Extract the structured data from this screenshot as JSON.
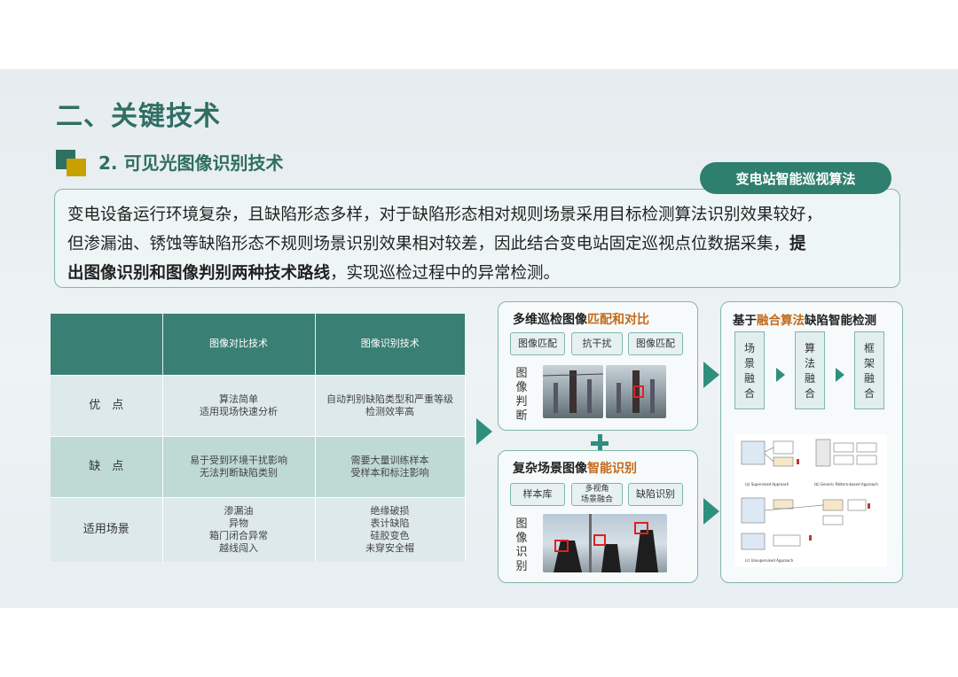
{
  "slide": {
    "title": "二、关键技术",
    "subtitle": "2. 可见光图像识别技术",
    "badge": "变电站智能巡视算法",
    "intro": {
      "line1": "变电设备运行环境复杂，且缺陷形态多样，对于缺陷形态相对规则场景采用目标检测算法识别效果较好，",
      "line2a": "但渗漏油、锈蚀等缺陷形态不规则场景识别效果相对较差，因此结合变电站固定巡视点位数据采集，",
      "line2b": "提",
      "line3a": "出图像识别和图像判别两种技术路线",
      "line3b": "，实现巡检过程中的异常检测。"
    }
  },
  "table": {
    "headers": [
      "",
      "图像对比技术",
      "图像识别技术"
    ],
    "rows": [
      {
        "label": "优　点",
        "col1": [
          "算法简单",
          "适用现场快速分析"
        ],
        "col2": [
          "自动判别缺陷类型和严重等级",
          "检测效率高"
        ]
      },
      {
        "label": "缺　点",
        "col1": [
          "易于受到环境干扰影响",
          "无法判断缺陷类别"
        ],
        "col2": [
          "需要大量训练样本",
          "受样本和标注影响"
        ]
      },
      {
        "label": "适用场景",
        "col1": [
          "渗漏油",
          "异物",
          "箱门闭合异常",
          "越线闯入"
        ],
        "col2": [
          "绝缘破损",
          "表计缺陷",
          "硅胶变色",
          "未穿安全帽"
        ]
      }
    ]
  },
  "panel_compare": {
    "title_a": "多维巡检图像",
    "title_hl": "匹配和对比",
    "chips": [
      "图像匹配",
      "抗干扰",
      "图像匹配"
    ],
    "vlabel": [
      "图",
      "像",
      "判",
      "断"
    ]
  },
  "panel_recognize": {
    "title_a": "复杂场景图像",
    "title_hl": "智能识别",
    "chips": [
      "样本库",
      "多视角\n场景融合",
      "缺陷识别"
    ],
    "vlabel": [
      "图",
      "像",
      "识",
      "别"
    ]
  },
  "panel_fusion": {
    "title_a": "基于",
    "title_hl": "融合算法",
    "title_b": "缺陷智能检测",
    "boxes": [
      [
        "场",
        "景",
        "融",
        "合"
      ],
      [
        "算",
        "法",
        "融",
        "合"
      ],
      [
        "框",
        "架",
        "融",
        "合"
      ]
    ],
    "diagram_labels": [
      "(a) Supervised Approach",
      "(b) Generic Pattern-based Approach",
      "(c) Unsupervised Approach"
    ]
  },
  "colors": {
    "accent": "#2f6f64",
    "arrow": "#2f8f7d",
    "highlight": "#c26a1a",
    "pill": "#2f7f6e"
  }
}
